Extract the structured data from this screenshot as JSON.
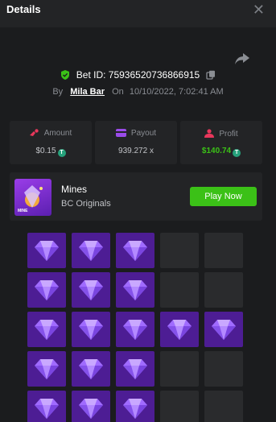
{
  "header": {
    "title": "Details",
    "close_icon": "close-icon"
  },
  "share_icon": "share-icon",
  "bet": {
    "id_label": "Bet ID: 7593652073686691 5",
    "id_text": "Bet ID: 75936520736866915",
    "by_label": "By",
    "user": "Mila Bar",
    "on_label": "On",
    "datetime": "10/10/2022, 7:02:41 AM"
  },
  "stats": {
    "amount": {
      "label": "Amount",
      "value": "$0.15"
    },
    "payout": {
      "label": "Payout",
      "value": "939.272 x"
    },
    "profit": {
      "label": "Profit",
      "value": "$140.74"
    }
  },
  "game": {
    "name": "Mines",
    "provider": "BC Originals",
    "thumb_text": "MINE",
    "play_label": "Play Now"
  },
  "board": {
    "columns": 5,
    "rows_visible": 5,
    "tiles": [
      "gem",
      "gem",
      "gem",
      "empty",
      "empty",
      "gem",
      "gem",
      "gem",
      "empty",
      "empty",
      "gem",
      "gem",
      "gem",
      "gem",
      "gem",
      "gem",
      "gem",
      "gem",
      "empty",
      "empty",
      "gem",
      "gem",
      "gem",
      "empty",
      "empty"
    ]
  },
  "colors": {
    "accent_green": "#3bc117",
    "gem_tile": "#4d1d94",
    "empty_tile": "#2a2b2d"
  }
}
